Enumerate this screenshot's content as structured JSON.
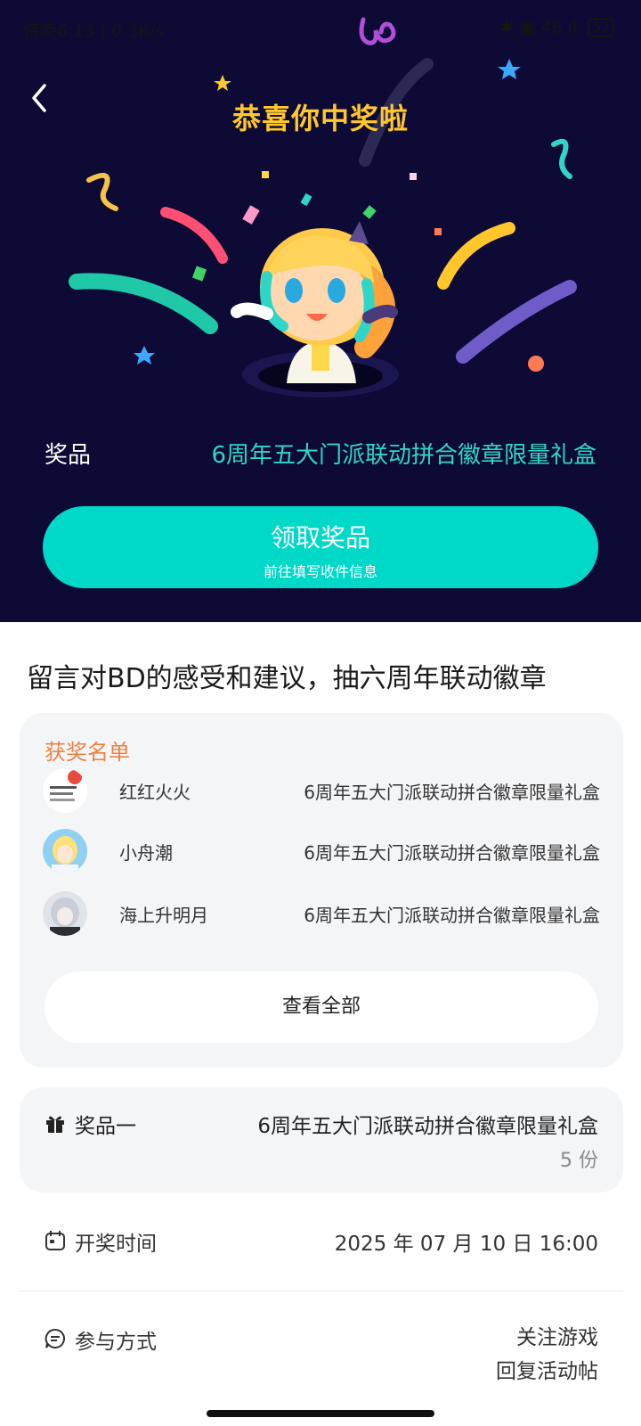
{
  "status_bar": {
    "left_text": "傍晚6:13 | 0.3K/s",
    "right_text": "✱ ▣ 46 ıl",
    "battery": "52"
  },
  "hero": {
    "title": "恭喜你中奖啦",
    "prize_label": "奖品",
    "prize_value": "6周年五大门派联动拼合徽章限量礼盒",
    "claim_button": {
      "title": "领取奖品",
      "subtitle": "前往填写收件信息"
    },
    "colors": {
      "background": "#0d0a35",
      "title": "#ffc72c",
      "accent": "#00d8c8"
    }
  },
  "main": {
    "title": "留言对BD的感受和建议，抽六周年联动徽章"
  },
  "winners": {
    "heading": "获奖名单",
    "rows": [
      {
        "name": "红红火火",
        "prize": "6周年五大门派联动拼合徽章限量礼盒",
        "avatar": "text-avatar"
      },
      {
        "name": "小舟潮",
        "prize": "6周年五大门派联动拼合徽章限量礼盒",
        "avatar": "anime-girl-avatar"
      },
      {
        "name": "海上升明月",
        "prize": "6周年五大门派联动拼合徽章限量礼盒",
        "avatar": "silver-hair-avatar"
      }
    ],
    "view_all": "查看全部"
  },
  "prize_info": {
    "name": "奖品一",
    "full_name": "6周年五大门派联动拼合徽章限量礼盒",
    "quantity": "5 份",
    "icon": "gift-icon"
  },
  "draw_time": {
    "label": "开奖时间",
    "value": "2025 年 07 月 10 日 16:00",
    "icon": "calendar-icon"
  },
  "participation": {
    "label": "参与方式",
    "items": [
      "关注游戏",
      "回复活动帖"
    ],
    "icon": "chat-icon"
  }
}
